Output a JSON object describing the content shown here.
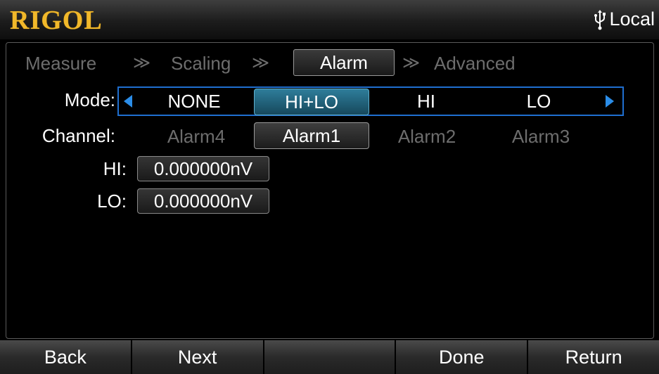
{
  "header": {
    "brand": "RIGOL",
    "status_label": "Local",
    "status_icon": "usb-icon"
  },
  "tabs": [
    {
      "label": "Measure",
      "active": false
    },
    {
      "label": "Scaling",
      "active": false
    },
    {
      "label": "Alarm",
      "active": true
    },
    {
      "label": "Advanced",
      "active": false
    }
  ],
  "tab_separator": "≫",
  "mode": {
    "label": "Mode:",
    "options": [
      "NONE",
      "HI+LO",
      "HI",
      "LO"
    ],
    "selected": "HI+LO"
  },
  "channel": {
    "label": "Channel:",
    "options": [
      "Alarm4",
      "Alarm1",
      "Alarm2",
      "Alarm3"
    ],
    "selected": "Alarm1"
  },
  "hi": {
    "label": "HI:",
    "value": "0.000000nV"
  },
  "lo": {
    "label": "LO:",
    "value": "0.000000nV"
  },
  "softkeys": [
    "Back",
    "Next",
    "",
    "Done",
    "Return"
  ],
  "colors": {
    "brand": "#f1b82a",
    "accent_blue": "#1f6fd0",
    "selected_blue": "#2e7d9a",
    "dim_text": "#6d6d6d"
  }
}
